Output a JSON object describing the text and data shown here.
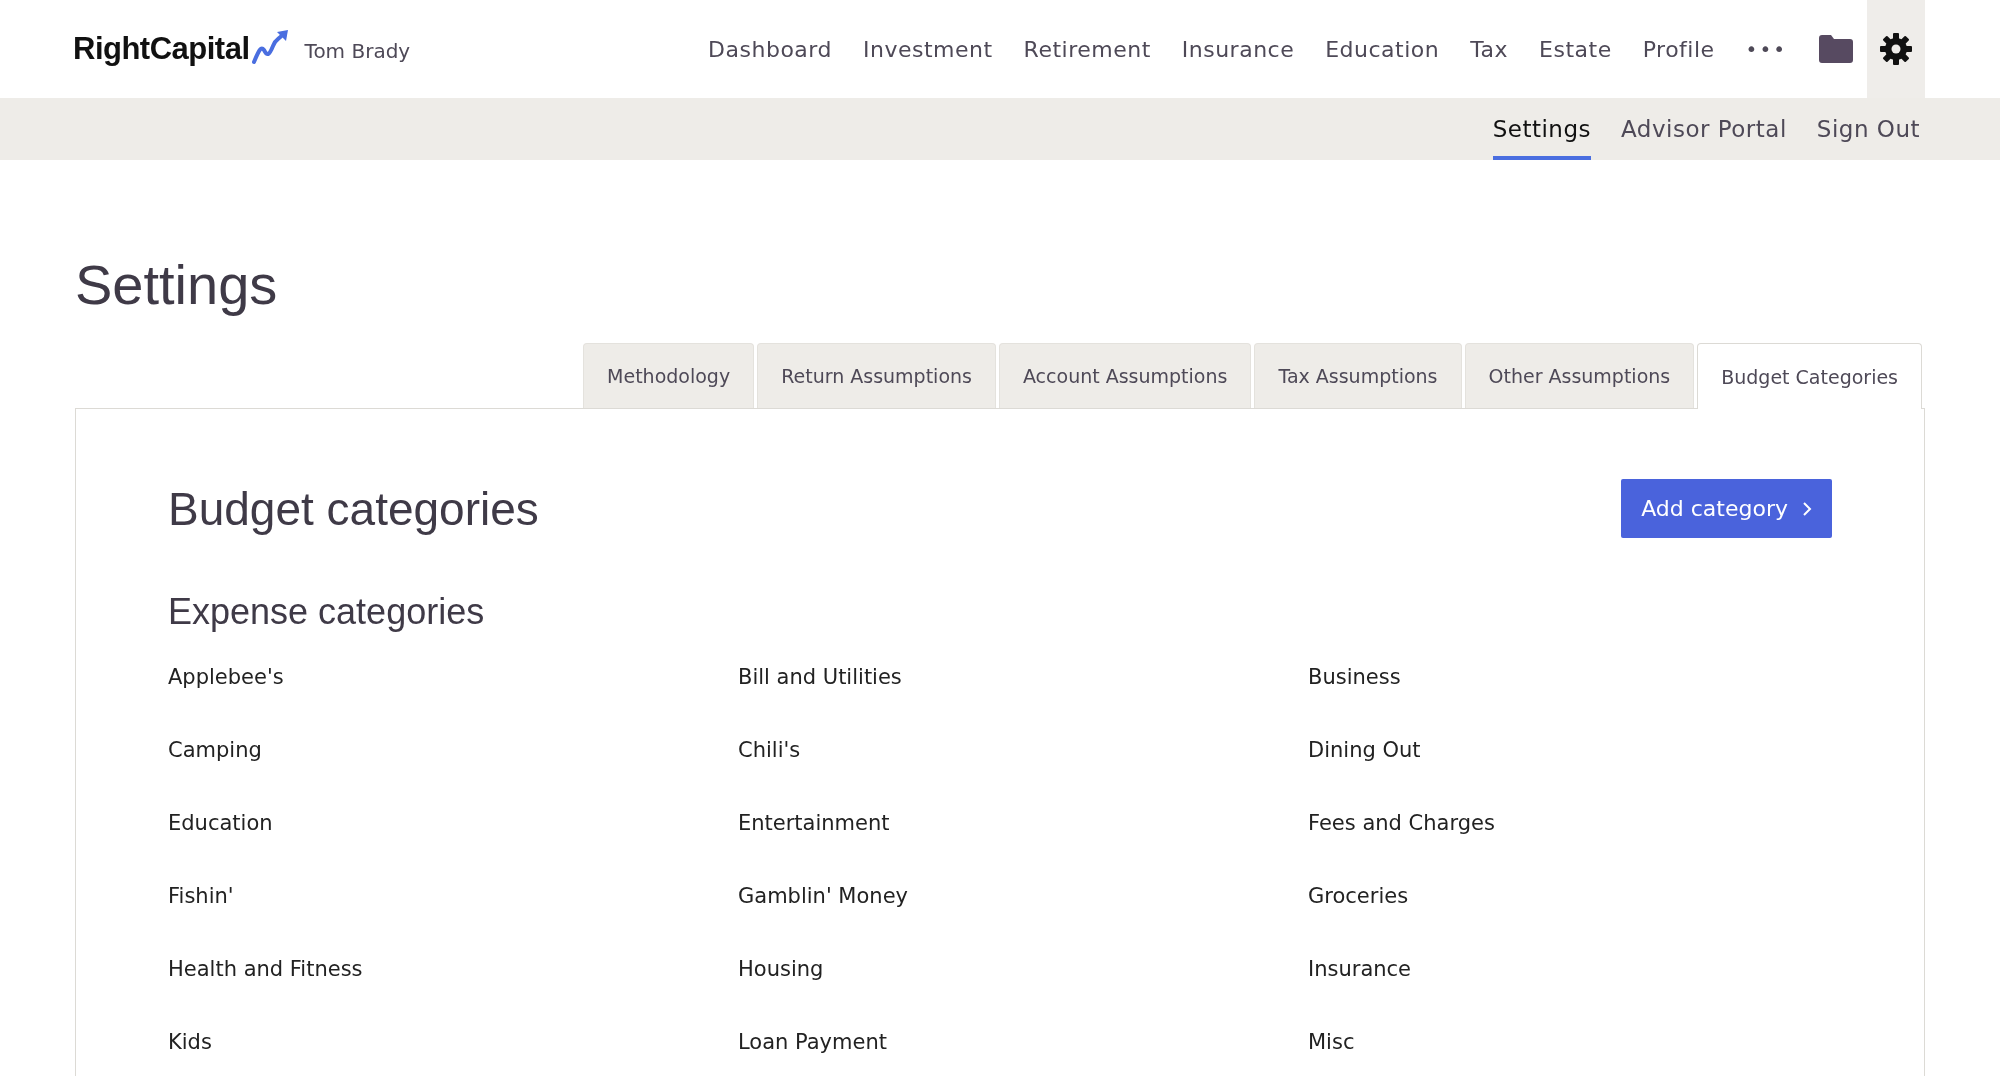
{
  "header": {
    "brand": "RightCapital",
    "client": "Tom Brady",
    "nav": [
      {
        "label": "Dashboard"
      },
      {
        "label": "Investment"
      },
      {
        "label": "Retirement"
      },
      {
        "label": "Insurance"
      },
      {
        "label": "Education"
      },
      {
        "label": "Tax"
      },
      {
        "label": "Estate"
      },
      {
        "label": "Profile"
      }
    ],
    "more": "•••"
  },
  "subnav": [
    {
      "label": "Settings",
      "selected": true
    },
    {
      "label": "Advisor Portal",
      "selected": false
    },
    {
      "label": "Sign Out",
      "selected": false
    }
  ],
  "page_title": "Settings",
  "tabs": [
    {
      "label": "Methodology",
      "selected": false
    },
    {
      "label": "Return Assumptions",
      "selected": false
    },
    {
      "label": "Account Assumptions",
      "selected": false
    },
    {
      "label": "Tax Assumptions",
      "selected": false
    },
    {
      "label": "Other Assumptions",
      "selected": false
    },
    {
      "label": "Budget Categories",
      "selected": true
    }
  ],
  "panel": {
    "title": "Budget categories",
    "add_button": "Add category",
    "section": "Expense categories",
    "categories": [
      "Applebee's",
      "Bill and Utilities",
      "Business",
      "Camping",
      "Chili's",
      "Dining Out",
      "Education",
      "Entertainment",
      "Fees and Charges",
      "Fishin'",
      "Gamblin' Money",
      "Groceries",
      "Health and Fitness",
      "Housing",
      "Insurance",
      "Kids",
      "Loan Payment",
      "Misc"
    ]
  }
}
